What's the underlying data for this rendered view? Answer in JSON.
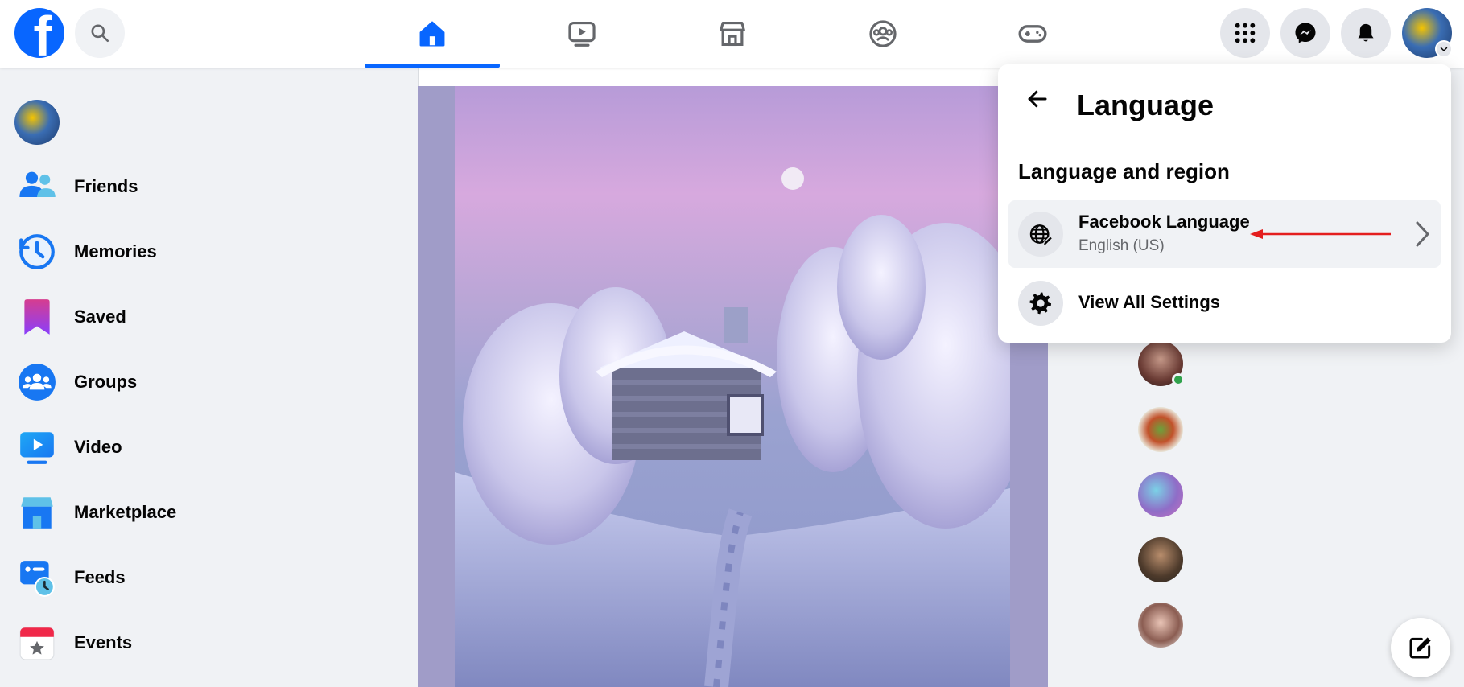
{
  "topbar": {
    "logo_letter": "f",
    "nav_tabs": [
      {
        "name": "home-icon",
        "active": true
      },
      {
        "name": "video-icon",
        "active": false
      },
      {
        "name": "marketplace-icon",
        "active": false
      },
      {
        "name": "groups-icon",
        "active": false
      },
      {
        "name": "gaming-icon",
        "active": false
      }
    ],
    "right_buttons": [
      "menu-grid-icon",
      "messenger-icon",
      "notifications-icon"
    ]
  },
  "sidebar": {
    "items": [
      {
        "label": "Friends",
        "icon": "friends-icon"
      },
      {
        "label": "Memories",
        "icon": "memories-icon"
      },
      {
        "label": "Saved",
        "icon": "saved-icon"
      },
      {
        "label": "Groups",
        "icon": "groups-icon"
      },
      {
        "label": "Video",
        "icon": "video-icon"
      },
      {
        "label": "Marketplace",
        "icon": "marketplace-icon"
      },
      {
        "label": "Feeds",
        "icon": "feeds-icon"
      },
      {
        "label": "Events",
        "icon": "events-icon"
      }
    ]
  },
  "language_panel": {
    "title": "Language",
    "section_title": "Language and region",
    "language_row": {
      "label": "Facebook Language",
      "value": "English (US)"
    },
    "settings_row": {
      "label": "View All Settings"
    }
  },
  "colors": {
    "accent": "#0866ff",
    "annotation_arrow": "#e41e1e",
    "online": "#31a24c"
  }
}
